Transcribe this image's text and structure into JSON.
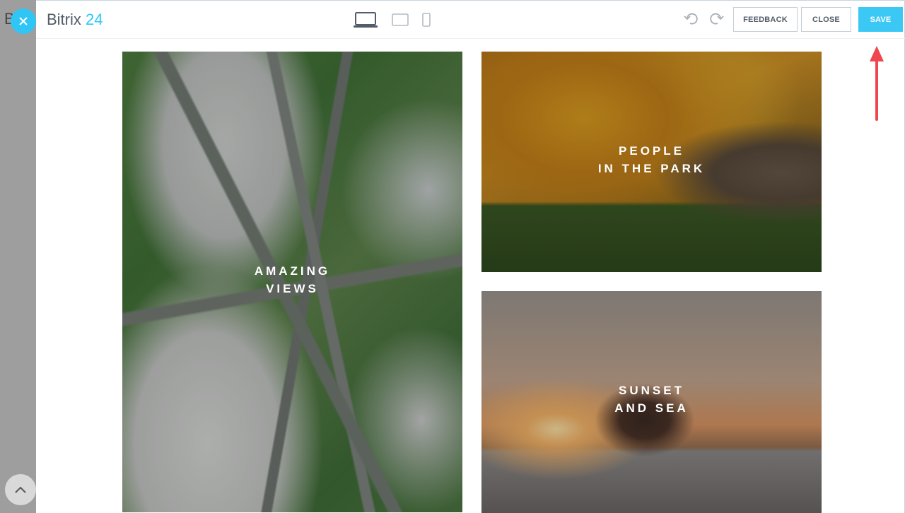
{
  "background": {
    "cut_letter": "B"
  },
  "header": {
    "logo_main": "Bitrix",
    "logo_number": "24",
    "feedback_label": "FEEDBACK",
    "close_label": "CLOSE",
    "save_label": "SAVE"
  },
  "devices": [
    "desktop-icon",
    "tablet-icon",
    "mobile-icon"
  ],
  "tiles": [
    {
      "line1": "AMAZING",
      "line2": "VIEWS"
    },
    {
      "line1": "PEOPLE",
      "line2": "IN THE PARK"
    },
    {
      "line1": "SUNSET",
      "line2": "AND SEA"
    }
  ],
  "colors": {
    "accent": "#2fc6f6",
    "save": "#3bc8f5",
    "arrow": "#f0474f"
  }
}
